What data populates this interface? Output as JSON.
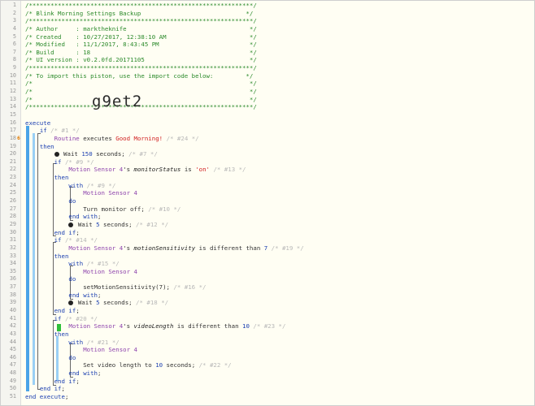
{
  "editor": {
    "import_code": "g9et2",
    "lines": [
      {
        "n": "1",
        "code": [
          {
            "t": "c",
            "v": "/**************************************************************/"
          }
        ]
      },
      {
        "n": "2",
        "code": [
          {
            "t": "c",
            "v": "/* Blink Morning Settings Backup                             */"
          }
        ]
      },
      {
        "n": "3",
        "code": [
          {
            "t": "c",
            "v": "/**************************************************************/"
          }
        ]
      },
      {
        "n": "4",
        "code": [
          {
            "t": "c",
            "v": "/* Author     : marktheknife                                  */"
          }
        ]
      },
      {
        "n": "5",
        "code": [
          {
            "t": "c",
            "v": "/* Created    : 10/27/2017, 12:38:10 AM                       */"
          }
        ]
      },
      {
        "n": "6",
        "code": [
          {
            "t": "c",
            "v": "/* Modified   : 11/1/2017, 8:43:45 PM                         */"
          }
        ]
      },
      {
        "n": "7",
        "code": [
          {
            "t": "c",
            "v": "/* Build      : 18                                            */"
          }
        ]
      },
      {
        "n": "8",
        "code": [
          {
            "t": "c",
            "v": "/* UI version : v0.2.0fd.20171105                             */"
          }
        ]
      },
      {
        "n": "9",
        "code": [
          {
            "t": "c",
            "v": "/**************************************************************/"
          }
        ]
      },
      {
        "n": "10",
        "code": [
          {
            "t": "c",
            "v": "/* To import this piston, use the import code below:         */"
          }
        ]
      },
      {
        "n": "11",
        "code": [
          {
            "t": "c",
            "v": "/*                                                            */"
          }
        ]
      },
      {
        "n": "12",
        "code": [
          {
            "t": "c",
            "v": "/*                                                            */"
          }
        ]
      },
      {
        "n": "13",
        "code": [
          {
            "t": "c",
            "v": "/*                                                            */"
          }
        ]
      },
      {
        "n": "14",
        "code": [
          {
            "t": "c",
            "v": "/**************************************************************/"
          }
        ]
      },
      {
        "n": "15",
        "code": [
          {
            "t": "plain",
            "v": ""
          }
        ]
      },
      {
        "n": "16",
        "code": [
          {
            "t": "k",
            "v": "execute"
          }
        ]
      },
      {
        "n": "17",
        "code": [
          {
            "t": "plain",
            "v": "    "
          },
          {
            "t": "k",
            "v": "if"
          },
          {
            "t": "id",
            "v": " /* #1 */"
          }
        ]
      },
      {
        "n": "18",
        "marker": "6",
        "code": [
          {
            "t": "plain",
            "v": "        "
          },
          {
            "t": "d",
            "v": "Routine"
          },
          {
            "t": "plain",
            "v": " executes "
          },
          {
            "t": "s",
            "v": "Good Morning!"
          },
          {
            "t": "id",
            "v": " /* #24 */"
          }
        ]
      },
      {
        "n": "19",
        "code": [
          {
            "t": "plain",
            "v": "    "
          },
          {
            "t": "k",
            "v": "then"
          }
        ]
      },
      {
        "n": "20",
        "code": [
          {
            "t": "plain",
            "v": "        "
          },
          {
            "t": "icon",
            "v": ""
          },
          {
            "t": "plain",
            "v": " Wait "
          },
          {
            "t": "n",
            "v": "150"
          },
          {
            "t": "plain",
            "v": " seconds;"
          },
          {
            "t": "id",
            "v": " /* #7 */"
          }
        ]
      },
      {
        "n": "21",
        "code": [
          {
            "t": "plain",
            "v": "        "
          },
          {
            "t": "k",
            "v": "if"
          },
          {
            "t": "id",
            "v": " /* #9 */"
          }
        ]
      },
      {
        "n": "22",
        "code": [
          {
            "t": "plain",
            "v": "            "
          },
          {
            "t": "d",
            "v": "Motion Sensor 4"
          },
          {
            "t": "plain",
            "v": "'s "
          },
          {
            "t": "var",
            "v": "monitorStatus"
          },
          {
            "t": "plain",
            "v": " is "
          },
          {
            "t": "s",
            "v": "'on'"
          },
          {
            "t": "id",
            "v": " /* #13 */"
          }
        ]
      },
      {
        "n": "23",
        "code": [
          {
            "t": "plain",
            "v": "        "
          },
          {
            "t": "k",
            "v": "then"
          }
        ]
      },
      {
        "n": "24",
        "code": [
          {
            "t": "plain",
            "v": "            "
          },
          {
            "t": "k",
            "v": "with"
          },
          {
            "t": "id",
            "v": " /* #9 */"
          }
        ]
      },
      {
        "n": "25",
        "code": [
          {
            "t": "plain",
            "v": "                "
          },
          {
            "t": "d",
            "v": "Motion Sensor 4"
          }
        ]
      },
      {
        "n": "26",
        "code": [
          {
            "t": "plain",
            "v": "            "
          },
          {
            "t": "k",
            "v": "do"
          }
        ]
      },
      {
        "n": "27",
        "code": [
          {
            "t": "plain",
            "v": "                Turn monitor off;"
          },
          {
            "t": "id",
            "v": " /* #10 */"
          }
        ]
      },
      {
        "n": "28",
        "code": [
          {
            "t": "plain",
            "v": "            "
          },
          {
            "t": "k",
            "v": "end with"
          },
          {
            "t": "plain",
            "v": ";"
          }
        ]
      },
      {
        "n": "29",
        "code": [
          {
            "t": "plain",
            "v": "            "
          },
          {
            "t": "icon",
            "v": ""
          },
          {
            "t": "plain",
            "v": " Wait "
          },
          {
            "t": "n",
            "v": "5"
          },
          {
            "t": "plain",
            "v": " seconds;"
          },
          {
            "t": "id",
            "v": " /* #12 */"
          }
        ]
      },
      {
        "n": "30",
        "code": [
          {
            "t": "plain",
            "v": "        "
          },
          {
            "t": "k",
            "v": "end if"
          },
          {
            "t": "plain",
            "v": ";"
          }
        ]
      },
      {
        "n": "31",
        "code": [
          {
            "t": "plain",
            "v": "        "
          },
          {
            "t": "k",
            "v": "if"
          },
          {
            "t": "id",
            "v": " /* #14 */"
          }
        ]
      },
      {
        "n": "32",
        "code": [
          {
            "t": "plain",
            "v": "            "
          },
          {
            "t": "d",
            "v": "Motion Sensor 4"
          },
          {
            "t": "plain",
            "v": "'s "
          },
          {
            "t": "var",
            "v": "motionSensitivity"
          },
          {
            "t": "plain",
            "v": " is different than "
          },
          {
            "t": "n",
            "v": "7"
          },
          {
            "t": "id",
            "v": " /* #19 */"
          }
        ]
      },
      {
        "n": "33",
        "code": [
          {
            "t": "plain",
            "v": "        "
          },
          {
            "t": "k",
            "v": "then"
          }
        ]
      },
      {
        "n": "34",
        "code": [
          {
            "t": "plain",
            "v": "            "
          },
          {
            "t": "k",
            "v": "with"
          },
          {
            "t": "id",
            "v": " /* #15 */"
          }
        ]
      },
      {
        "n": "35",
        "code": [
          {
            "t": "plain",
            "v": "                "
          },
          {
            "t": "d",
            "v": "Motion Sensor 4"
          }
        ]
      },
      {
        "n": "36",
        "code": [
          {
            "t": "plain",
            "v": "            "
          },
          {
            "t": "k",
            "v": "do"
          }
        ]
      },
      {
        "n": "37",
        "code": [
          {
            "t": "plain",
            "v": "                setMotionSensitivity(7);"
          },
          {
            "t": "id",
            "v": " /* #16 */"
          }
        ]
      },
      {
        "n": "38",
        "code": [
          {
            "t": "plain",
            "v": "            "
          },
          {
            "t": "k",
            "v": "end with"
          },
          {
            "t": "plain",
            "v": ";"
          }
        ]
      },
      {
        "n": "39",
        "code": [
          {
            "t": "plain",
            "v": "            "
          },
          {
            "t": "icon",
            "v": ""
          },
          {
            "t": "plain",
            "v": " Wait "
          },
          {
            "t": "n",
            "v": "5"
          },
          {
            "t": "plain",
            "v": " seconds;"
          },
          {
            "t": "id",
            "v": " /* #18 */"
          }
        ]
      },
      {
        "n": "40",
        "code": [
          {
            "t": "plain",
            "v": "        "
          },
          {
            "t": "k",
            "v": "end if"
          },
          {
            "t": "plain",
            "v": ";"
          }
        ]
      },
      {
        "n": "41",
        "code": [
          {
            "t": "plain",
            "v": "        "
          },
          {
            "t": "k",
            "v": "if"
          },
          {
            "t": "id",
            "v": " /* #20 */"
          }
        ]
      },
      {
        "n": "42",
        "code": [
          {
            "t": "plain",
            "v": "            "
          },
          {
            "t": "d",
            "v": "Motion Sensor 4"
          },
          {
            "t": "plain",
            "v": "'s "
          },
          {
            "t": "var",
            "v": "videoLength"
          },
          {
            "t": "plain",
            "v": " is different than "
          },
          {
            "t": "n",
            "v": "10"
          },
          {
            "t": "id",
            "v": " /* #23 */"
          }
        ]
      },
      {
        "n": "43",
        "code": [
          {
            "t": "plain",
            "v": "        "
          },
          {
            "t": "k",
            "v": "then"
          }
        ]
      },
      {
        "n": "44",
        "code": [
          {
            "t": "plain",
            "v": "            "
          },
          {
            "t": "k",
            "v": "with"
          },
          {
            "t": "id",
            "v": " /* #21 */"
          }
        ]
      },
      {
        "n": "45",
        "code": [
          {
            "t": "plain",
            "v": "                "
          },
          {
            "t": "d",
            "v": "Motion Sensor 4"
          }
        ]
      },
      {
        "n": "46",
        "code": [
          {
            "t": "plain",
            "v": "            "
          },
          {
            "t": "k",
            "v": "do"
          }
        ]
      },
      {
        "n": "47",
        "code": [
          {
            "t": "plain",
            "v": "                Set video length to "
          },
          {
            "t": "n",
            "v": "10"
          },
          {
            "t": "plain",
            "v": " seconds;"
          },
          {
            "t": "id",
            "v": " /* #22 */"
          }
        ]
      },
      {
        "n": "48",
        "code": [
          {
            "t": "plain",
            "v": "            "
          },
          {
            "t": "k",
            "v": "end with"
          },
          {
            "t": "plain",
            "v": ";"
          }
        ]
      },
      {
        "n": "49",
        "code": [
          {
            "t": "plain",
            "v": "        "
          },
          {
            "t": "k",
            "v": "end if"
          },
          {
            "t": "plain",
            "v": ";"
          }
        ]
      },
      {
        "n": "50",
        "code": [
          {
            "t": "plain",
            "v": "    "
          },
          {
            "t": "k",
            "v": "end if"
          },
          {
            "t": "plain",
            "v": ";"
          }
        ]
      },
      {
        "n": "51",
        "code": [
          {
            "t": "k",
            "v": "end execute"
          },
          {
            "t": "plain",
            "v": ";"
          }
        ]
      }
    ]
  }
}
